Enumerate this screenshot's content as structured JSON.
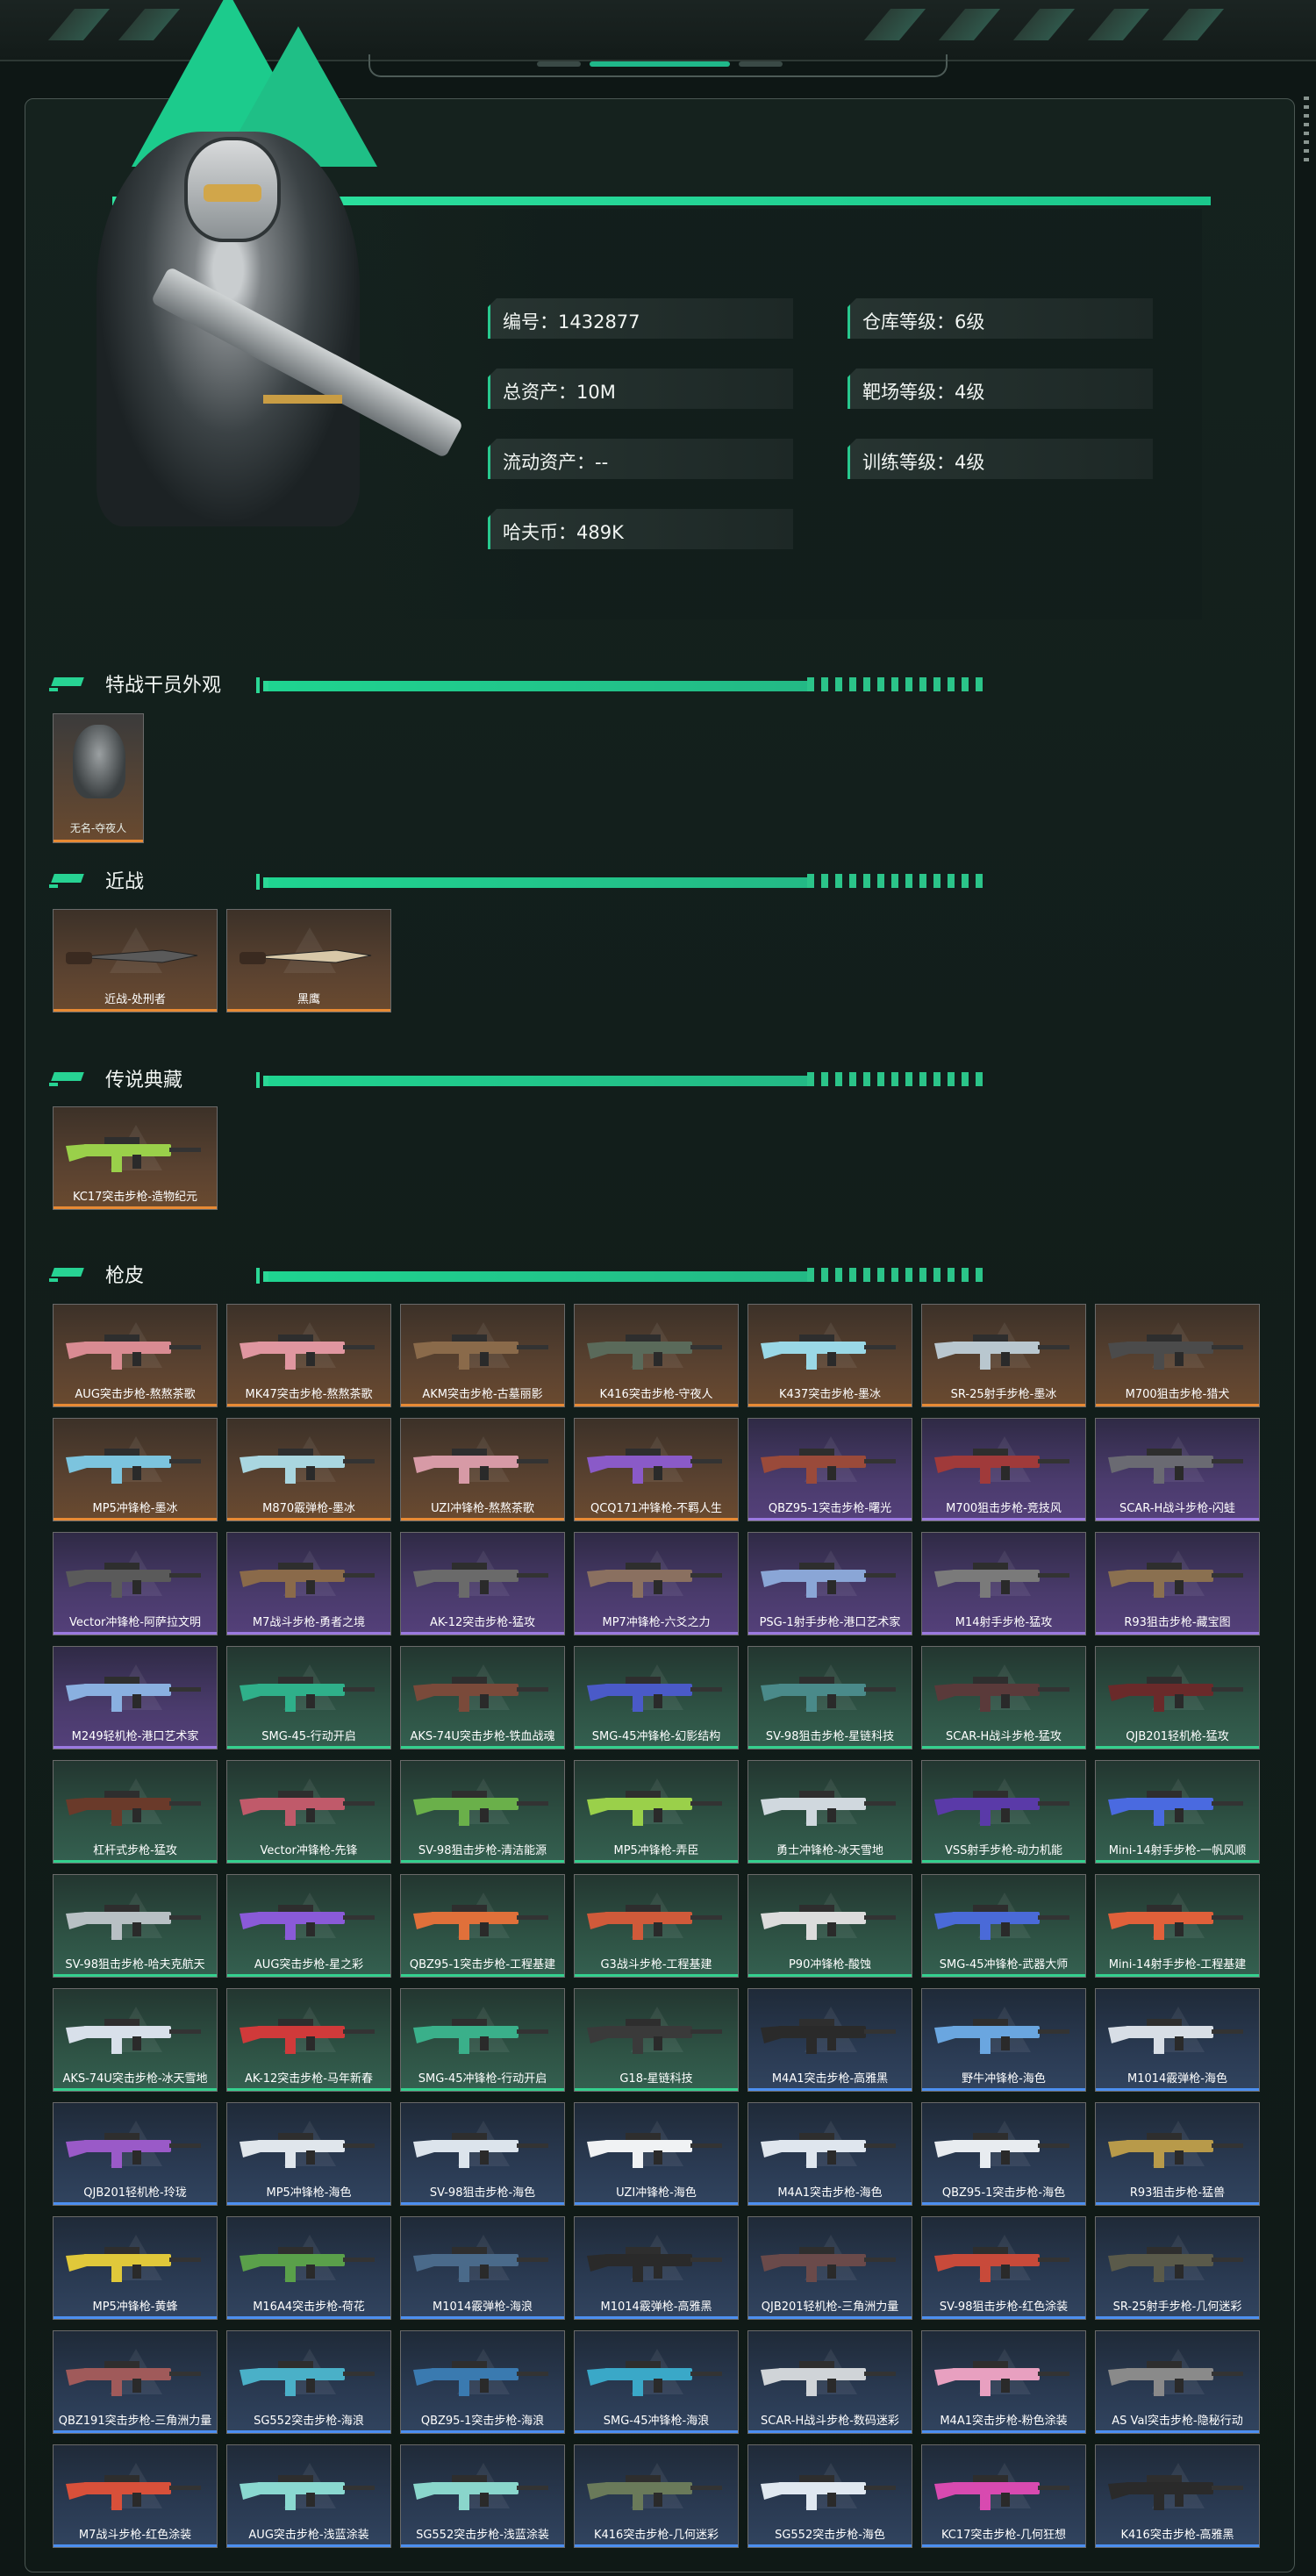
{
  "profile": {
    "id_label": "编号：1432877",
    "total_assets": "总资产：10M",
    "liquid_assets": "流动资产：--",
    "havcoin": "哈夫币：489K",
    "warehouse_level": "仓库等级：6级",
    "range_level": "靶场等级：4级",
    "training_level": "训练等级：4级"
  },
  "sections": {
    "operator": "特战干员外观",
    "melee": "近战",
    "legendary": "传说典藏",
    "skins": "枪皮"
  },
  "operator_items": [
    {
      "label": "无名-夺夜人",
      "rarity": "orange"
    }
  ],
  "melee_items": [
    {
      "label": "近战-处刑者",
      "rarity": "orange"
    },
    {
      "label": "黑鹰",
      "rarity": "orange"
    }
  ],
  "legendary_items": [
    {
      "label": "KC17突击步枪-造物纪元",
      "rarity": "orange"
    }
  ],
  "skins": [
    {
      "label": "AUG突击步枪-熬熬茶歌",
      "rarity": "orange",
      "color": "#d98b92"
    },
    {
      "label": "MK47突击步枪-熬熬茶歌",
      "rarity": "orange",
      "color": "#e096a0"
    },
    {
      "label": "AKM突击步枪-古墓丽影",
      "rarity": "orange",
      "color": "#8a6a4a"
    },
    {
      "label": "K416突击步枪-守夜人",
      "rarity": "orange",
      "color": "#5a6a5a"
    },
    {
      "label": "K437突击步枪-墨冰",
      "rarity": "orange",
      "color": "#9ad8e6"
    },
    {
      "label": "SR-25射手步枪-墨冰",
      "rarity": "orange",
      "color": "#b9c7cf"
    },
    {
      "label": "M700狙击步枪-猎犬",
      "rarity": "orange",
      "color": "#4b4b4b"
    },
    {
      "label": "MP5冲锋枪-墨冰",
      "rarity": "orange",
      "color": "#7cc4de"
    },
    {
      "label": "M870霰弹枪-墨冰",
      "rarity": "orange",
      "color": "#a9d6e0"
    },
    {
      "label": "UZI冲锋枪-熬熬茶歌",
      "rarity": "orange",
      "color": "#d79aa6"
    },
    {
      "label": "QCQ171冲锋枪-不羁人生",
      "rarity": "orange",
      "color": "#8a5ac8"
    },
    {
      "label": "QBZ95-1突击步枪-曙光",
      "rarity": "purple",
      "color": "#9a4a3a"
    },
    {
      "label": "M700狙击步枪-竞技风",
      "rarity": "purple",
      "color": "#a03a3a"
    },
    {
      "label": "SCAR-H战斗步枪-闪蛙",
      "rarity": "purple",
      "color": "#6a6a72"
    },
    {
      "label": "Vector冲锋枪-阿萨拉文明",
      "rarity": "purple",
      "color": "#5a5a5a"
    },
    {
      "label": "M7战斗步枪-勇者之境",
      "rarity": "purple",
      "color": "#8a6a4a"
    },
    {
      "label": "AK-12突击步枪-猛攻",
      "rarity": "purple",
      "color": "#6a6a6a"
    },
    {
      "label": "MP7冲锋枪-六爻之力",
      "rarity": "purple",
      "color": "#8a7060"
    },
    {
      "label": "PSG-1射手步枪-港口艺术家",
      "rarity": "purple",
      "color": "#8aa6d6"
    },
    {
      "label": "M14射手步枪-猛攻",
      "rarity": "purple",
      "color": "#7a7a7a"
    },
    {
      "label": "R93狙击步枪-藏宝图",
      "rarity": "purple",
      "color": "#8a7050"
    },
    {
      "label": "M249轻机枪-港口艺术家",
      "rarity": "purple",
      "color": "#8ab0e0"
    },
    {
      "label": "SMG-45-行动开启",
      "rarity": "green",
      "color": "#2fb08a"
    },
    {
      "label": "AKS-74U突击步枪-铁血战魂",
      "rarity": "green",
      "color": "#7a4a3a"
    },
    {
      "label": "SMG-45冲锋枪-幻影结构",
      "rarity": "green",
      "color": "#4a5ac8"
    },
    {
      "label": "SV-98狙击步枪-星链科技",
      "rarity": "green",
      "color": "#4a8a8a"
    },
    {
      "label": "SCAR-H战斗步枪-猛攻",
      "rarity": "green",
      "color": "#5a3a3a"
    },
    {
      "label": "QJB201轻机枪-猛攻",
      "rarity": "green",
      "color": "#6a2a2a"
    },
    {
      "label": "杠杆式步枪-猛攻",
      "rarity": "green",
      "color": "#6a3a2a"
    },
    {
      "label": "Vector冲锋枪-先锋",
      "rarity": "green",
      "color": "#c05a6a"
    },
    {
      "label": "SV-98狙击步枪-清洁能源",
      "rarity": "green",
      "color": "#6ab04a"
    },
    {
      "label": "MP5冲锋枪-弄臣",
      "rarity": "green",
      "color": "#9ad04a"
    },
    {
      "label": "勇士冲锋枪-冰天雪地",
      "rarity": "green",
      "color": "#d0d8de"
    },
    {
      "label": "VSS射手步枪-动力机能",
      "rarity": "green",
      "color": "#5a3aa8"
    },
    {
      "label": "Mini-14射手步枪-一帆风顺",
      "rarity": "green",
      "color": "#4a6ae0"
    },
    {
      "label": "SV-98狙击步枪-哈夫克航天",
      "rarity": "green",
      "color": "#b8c0c4"
    },
    {
      "label": "AUG突击步枪-星之彩",
      "rarity": "green",
      "color": "#8a5ad8"
    },
    {
      "label": "QBZ95-1突击步枪-工程基建",
      "rarity": "green",
      "color": "#e0703a"
    },
    {
      "label": "G3战斗步枪-工程基建",
      "rarity": "green",
      "color": "#d05a3a"
    },
    {
      "label": "P90冲锋枪-酸蚀",
      "rarity": "green",
      "color": "#dcdcdc"
    },
    {
      "label": "SMG-45冲锋枪-武器大师",
      "rarity": "green",
      "color": "#4a6ad8"
    },
    {
      "label": "Mini-14射手步枪-工程基建",
      "rarity": "green",
      "color": "#e0603a"
    },
    {
      "label": "AKS-74U突击步枪-冰天雪地",
      "rarity": "green",
      "color": "#d8e0ea"
    },
    {
      "label": "AK-12突击步枪-马年新春",
      "rarity": "green",
      "color": "#d03a3a"
    },
    {
      "label": "SMG-45冲锋枪-行动开启",
      "rarity": "green",
      "color": "#3ab08a"
    },
    {
      "label": "G18-星链科技",
      "rarity": "green",
      "color": "#3a3a3a"
    },
    {
      "label": "M4A1突击步枪-高雅黑",
      "rarity": "blue",
      "color": "#2a2a2a"
    },
    {
      "label": "野牛冲锋枪-海色",
      "rarity": "blue",
      "color": "#6aa6e0"
    },
    {
      "label": "M1014霰弹枪-海色",
      "rarity": "blue",
      "color": "#d8dee6"
    },
    {
      "label": "QJB201轻机枪-玲珑",
      "rarity": "blue",
      "color": "#9a5ac8"
    },
    {
      "label": "MP5冲锋枪-海色",
      "rarity": "blue",
      "color": "#e0e6ec"
    },
    {
      "label": "SV-98狙击步枪-海色",
      "rarity": "blue",
      "color": "#dce4ec"
    },
    {
      "label": "UZI冲锋枪-海色",
      "rarity": "blue",
      "color": "#f0f2f4"
    },
    {
      "label": "M4A1突击步枪-海色",
      "rarity": "blue",
      "color": "#dfe6ee"
    },
    {
      "label": "QBZ95-1突击步枪-海色",
      "rarity": "blue",
      "color": "#e8ecf0"
    },
    {
      "label": "R93狙击步枪-猛兽",
      "rarity": "blue",
      "color": "#b89a4a"
    },
    {
      "label": "MP5冲锋枪-黄蜂",
      "rarity": "blue",
      "color": "#e0c83a"
    },
    {
      "label": "M16A4突击步枪-荷花",
      "rarity": "blue",
      "color": "#5aa04a"
    },
    {
      "label": "M1014霰弹枪-海浪",
      "rarity": "blue",
      "color": "#4a6a8a"
    },
    {
      "label": "M1014霰弹枪-高雅黑",
      "rarity": "blue",
      "color": "#2a2a2a"
    },
    {
      "label": "QJB201轻机枪-三角洲力量",
      "rarity": "blue",
      "color": "#6a4a4a"
    },
    {
      "label": "SV-98狙击步枪-红色涂装",
      "rarity": "blue",
      "color": "#c84a3a"
    },
    {
      "label": "SR-25射手步枪-几何迷彩",
      "rarity": "blue",
      "color": "#5a5a4a"
    },
    {
      "label": "QBZ191突击步枪-三角洲力量",
      "rarity": "blue",
      "color": "#a05a5a"
    },
    {
      "label": "SG552突击步枪-海浪",
      "rarity": "blue",
      "color": "#4ab0c8"
    },
    {
      "label": "QBZ95-1突击步枪-海浪",
      "rarity": "blue",
      "color": "#3a7ab0"
    },
    {
      "label": "SMG-45冲锋枪-海浪",
      "rarity": "blue",
      "color": "#3aa8c8"
    },
    {
      "label": "SCAR-H战斗步枪-数码迷彩",
      "rarity": "blue",
      "color": "#d0d4d8"
    },
    {
      "label": "M4A1突击步枪-粉色涂装",
      "rarity": "blue",
      "color": "#e8a0c0"
    },
    {
      "label": "AS Val突击步枪-隐秘行动",
      "rarity": "blue",
      "color": "#8a8a8a"
    },
    {
      "label": "M7战斗步枪-红色涂装",
      "rarity": "blue",
      "color": "#d8503a"
    },
    {
      "label": "AUG突击步枪-浅蓝涂装",
      "rarity": "blue",
      "color": "#8ad8d0"
    },
    {
      "label": "SG552突击步枪-浅蓝涂装",
      "rarity": "blue",
      "color": "#8ad6cc"
    },
    {
      "label": "K416突击步枪-几何迷彩",
      "rarity": "blue",
      "color": "#6a7a5a"
    },
    {
      "label": "SG552突击步枪-海色",
      "rarity": "blue",
      "color": "#e0e8f0"
    },
    {
      "label": "KC17突击步枪-几何狂想",
      "rarity": "blue",
      "color": "#d84ab0"
    },
    {
      "label": "K416突击步枪-高雅黑",
      "rarity": "blue",
      "color": "#2a2a2a"
    }
  ]
}
